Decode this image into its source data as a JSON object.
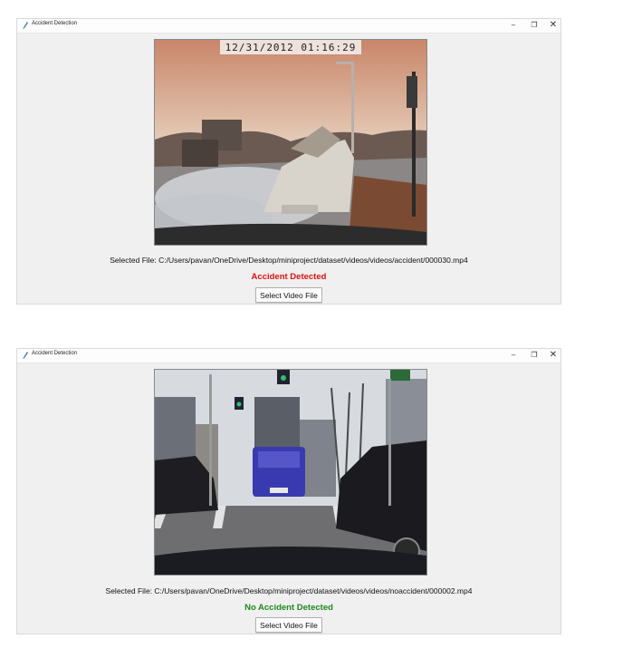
{
  "windows": [
    {
      "title": "Accident Detection",
      "controls": {
        "minimize": "–",
        "maximize": "❐",
        "close": "✕"
      },
      "video": {
        "timestamp": "12/31/2012 01:16:29"
      },
      "file_label": "Selected File: C:/Users/pavan/OneDrive/Desktop/miniproject/dataset/videos/videos/accident/000030.mp4",
      "status": {
        "text": "Accident Detected",
        "color": "#e01010"
      },
      "button_label": "Select Video File"
    },
    {
      "title": "Accident Detection",
      "controls": {
        "minimize": "–",
        "maximize": "❐",
        "close": "✕"
      },
      "video": {},
      "file_label": "Selected File: C:/Users/pavan/OneDrive/Desktop/miniproject/dataset/videos/videos/noaccident/000002.mp4",
      "status": {
        "text": "No Accident Detected",
        "color": "#1a8a1a"
      },
      "button_label": "Select Video File"
    }
  ]
}
